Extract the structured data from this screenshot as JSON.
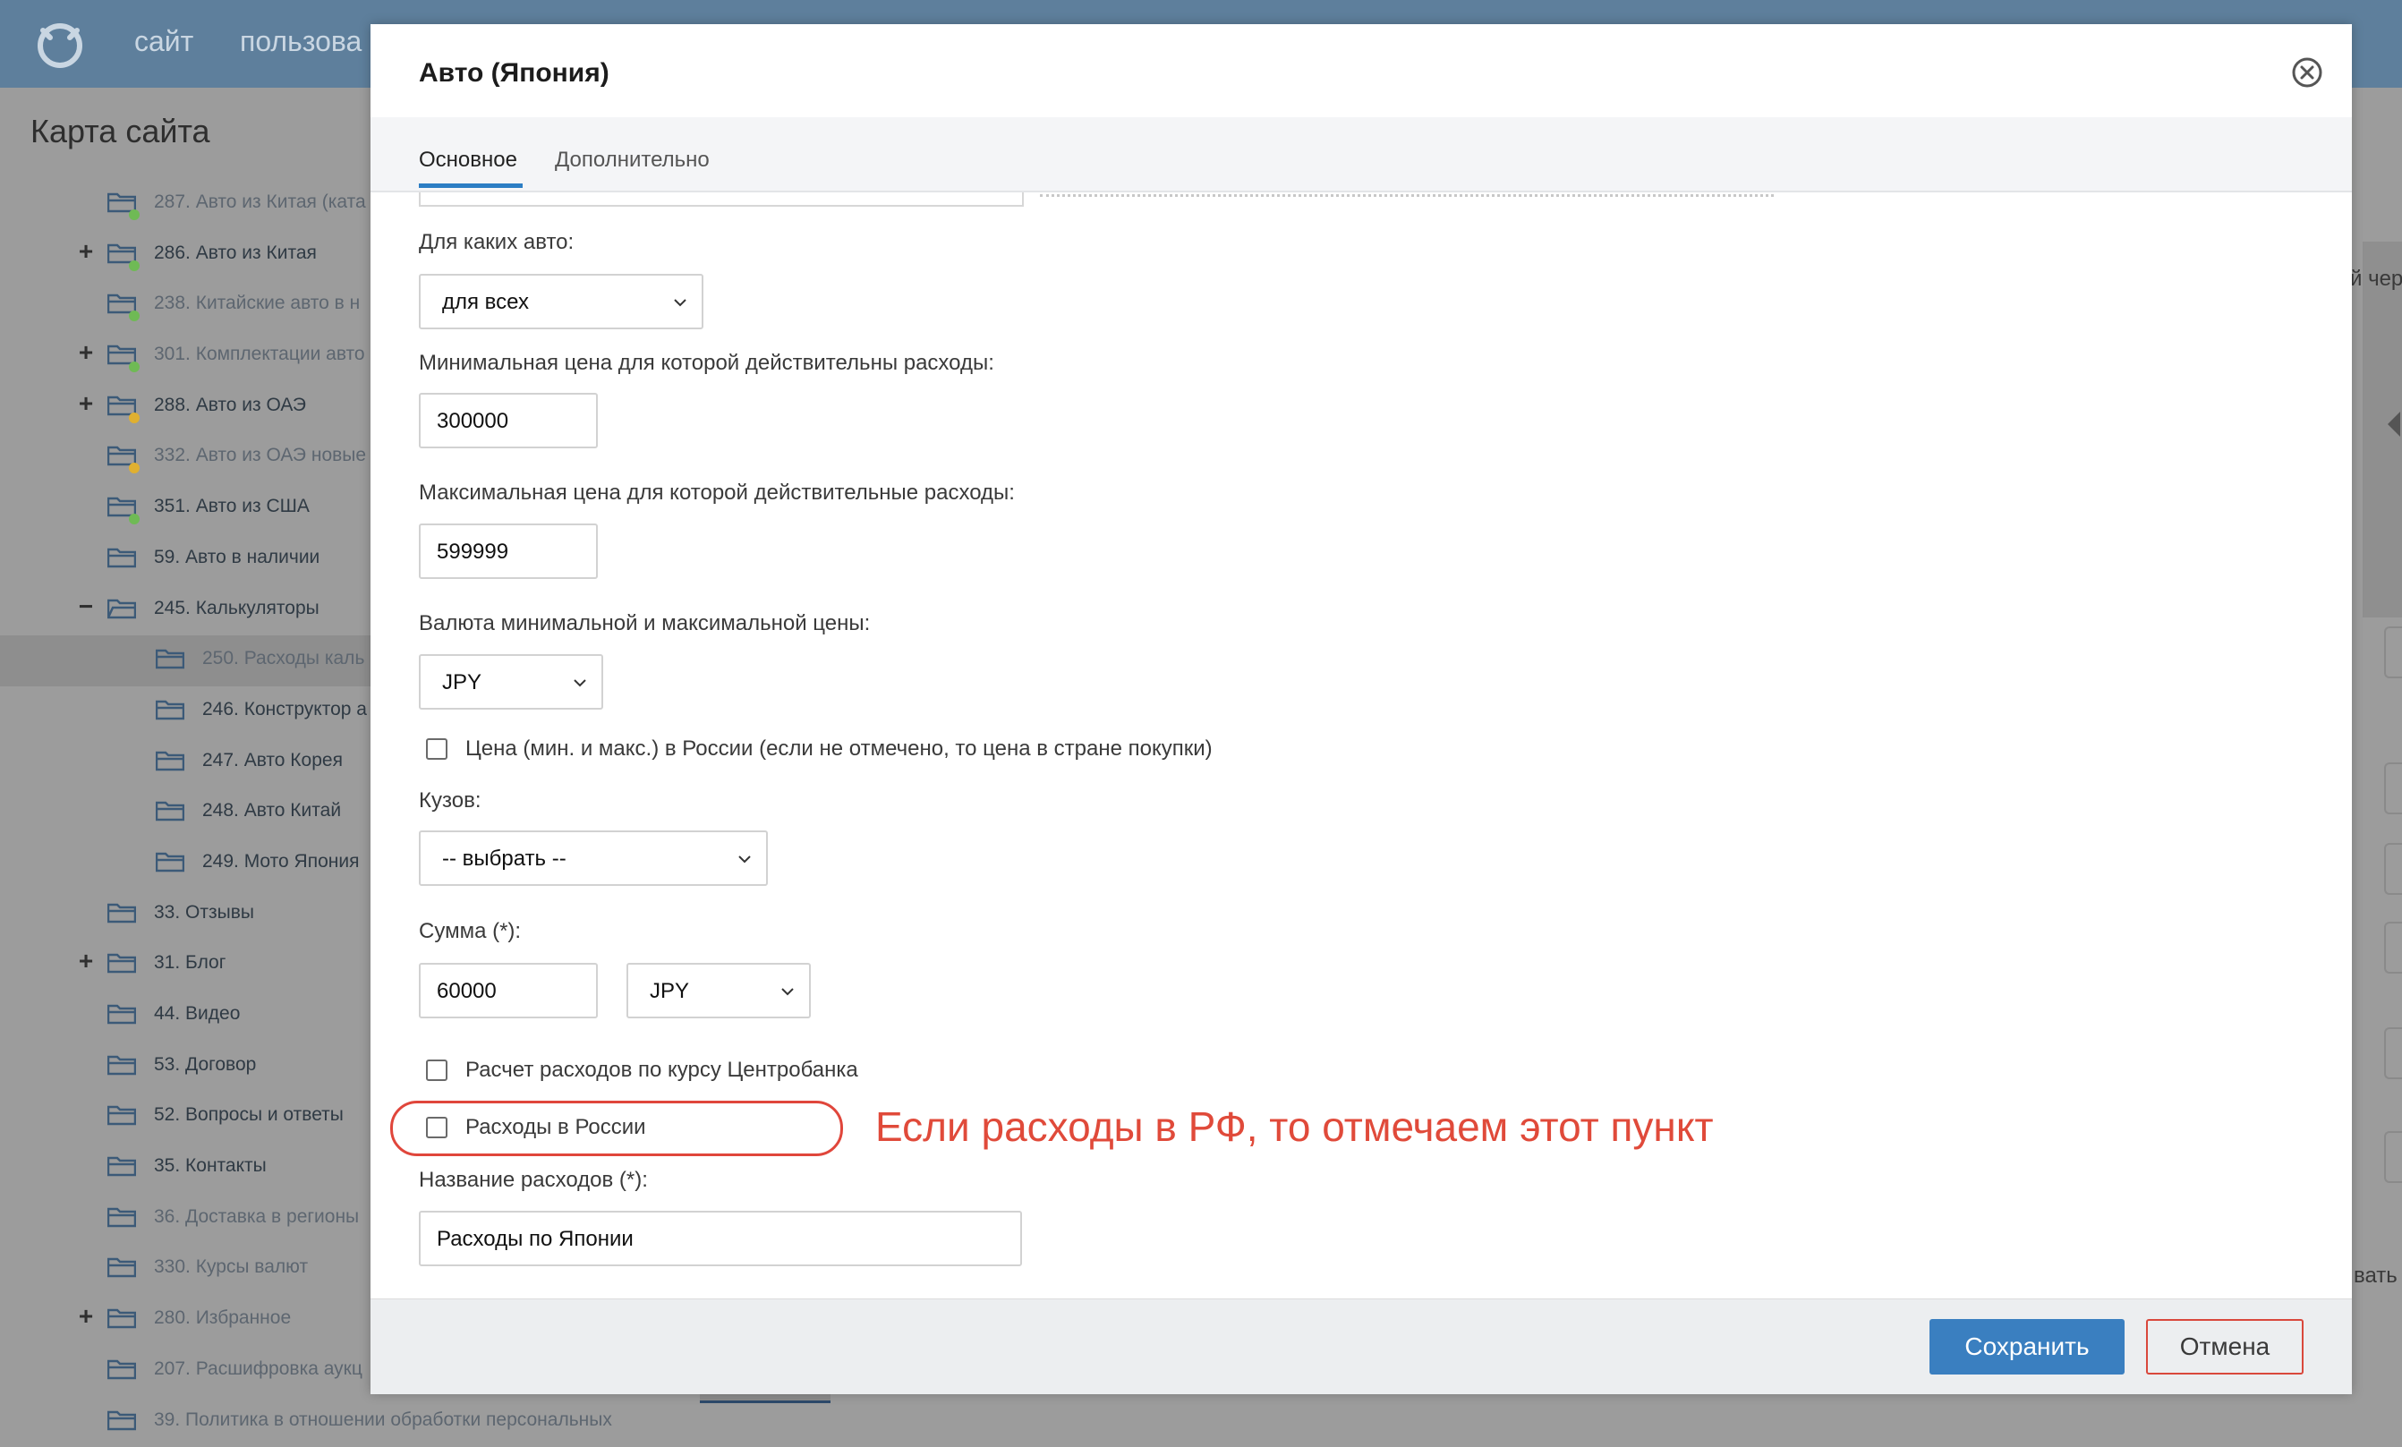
{
  "topbar": {
    "nav_items": [
      "сайт",
      "пользова"
    ]
  },
  "sidebar": {
    "title": "Карта сайта",
    "items": [
      {
        "label": "287. Авто из Китая (ката",
        "toggle": "",
        "dim": true,
        "dot": "#6fba55"
      },
      {
        "label": "286. Авто из Китая",
        "toggle": "+",
        "dim": false,
        "dot": "#6fba55"
      },
      {
        "label": "238. Китайские авто в н",
        "toggle": "",
        "dim": true,
        "dot": "#6fba55"
      },
      {
        "label": "301. Комплектации авто",
        "toggle": "+",
        "dim": true,
        "dot": "#6fba55"
      },
      {
        "label": "288. Авто из ОАЭ",
        "toggle": "+",
        "dim": false,
        "dot": "#e0b030"
      },
      {
        "label": "332. Авто из ОАЭ новые",
        "toggle": "",
        "dim": true,
        "dot": "#e0b030"
      },
      {
        "label": "351. Авто из США",
        "toggle": "",
        "dim": false,
        "dot": "#6fba55"
      },
      {
        "label": "59. Авто в наличии",
        "toggle": "",
        "dim": false,
        "dot": ""
      },
      {
        "label": "245. Калькуляторы",
        "toggle": "−",
        "dim": false,
        "dot": "",
        "open": true
      },
      {
        "label": "250. Расходы каль",
        "toggle": "",
        "dim": true,
        "dot": "",
        "child": true,
        "selected": true
      },
      {
        "label": "246. Конструктор а",
        "toggle": "",
        "dim": false,
        "dot": "",
        "child": true
      },
      {
        "label": "247. Авто Корея",
        "toggle": "",
        "dim": false,
        "dot": "",
        "child": true
      },
      {
        "label": "248. Авто Китай",
        "toggle": "",
        "dim": false,
        "dot": "",
        "child": true
      },
      {
        "label": "249. Мото Япония",
        "toggle": "",
        "dim": false,
        "dot": "",
        "child": true
      },
      {
        "label": "33. Отзывы",
        "toggle": "",
        "dim": false,
        "dot": ""
      },
      {
        "label": "31. Блог",
        "toggle": "+",
        "dim": false,
        "dot": ""
      },
      {
        "label": "44. Видео",
        "toggle": "",
        "dim": false,
        "dot": ""
      },
      {
        "label": "53. Договор",
        "toggle": "",
        "dim": false,
        "dot": ""
      },
      {
        "label": "52. Вопросы и ответы",
        "toggle": "",
        "dim": false,
        "dot": ""
      },
      {
        "label": "35. Контакты",
        "toggle": "",
        "dim": false,
        "dot": ""
      },
      {
        "label": "36. Доставка в регионы",
        "toggle": "",
        "dim": true,
        "dot": ""
      },
      {
        "label": "330. Курсы валют",
        "toggle": "",
        "dim": true,
        "dot": ""
      },
      {
        "label": "280. Избранное",
        "toggle": "+",
        "dim": true,
        "dot": ""
      },
      {
        "label": "207. Расшифровка аукц",
        "toggle": "",
        "dim": true,
        "dot": ""
      },
      {
        "label": "39. Политика в отношении обработки персональных",
        "toggle": "",
        "dim": true,
        "dot": ""
      }
    ]
  },
  "right_panel": {
    "text_top": "й чер",
    "text_bottom": "вать"
  },
  "modal": {
    "title": "Авто (Япония)",
    "tabs": [
      "Основное",
      "Дополнительно"
    ],
    "fields": {
      "car_type_label": "Для каких авто:",
      "car_type_value": "для всех",
      "min_price_label": "Минимальная цена для которой действительны расходы:",
      "min_price_value": "300000",
      "max_price_label": "Максимальная цена для которой действительные расходы:",
      "max_price_value": "599999",
      "currency_label": "Валюта минимальной и максимальной цены:",
      "currency_value": "JPY",
      "price_in_russia_label": "Цена (мин. и макс.) в России (если не отмечено, то цена в стране покупки)",
      "body_label": "Кузов:",
      "body_value": "-- выбрать --",
      "sum_label": "Сумма (*):",
      "sum_value": "60000",
      "sum_currency_value": "JPY",
      "cbr_rate_label": "Расчет расходов по курсу Центробанка",
      "expenses_russia_label": "Расходы в России",
      "expense_name_label": "Название расходов (*):",
      "expense_name_value": "Расходы по Японии"
    },
    "annotation": "Если расходы в РФ, то отмечаем этот пункт",
    "footer": {
      "save_label": "Сохранить",
      "cancel_label": "Отмена"
    }
  },
  "colors": {
    "accent": "#3a7fc0",
    "annotation": "#e04a3a",
    "header_bar": "#5e7f9c"
  }
}
